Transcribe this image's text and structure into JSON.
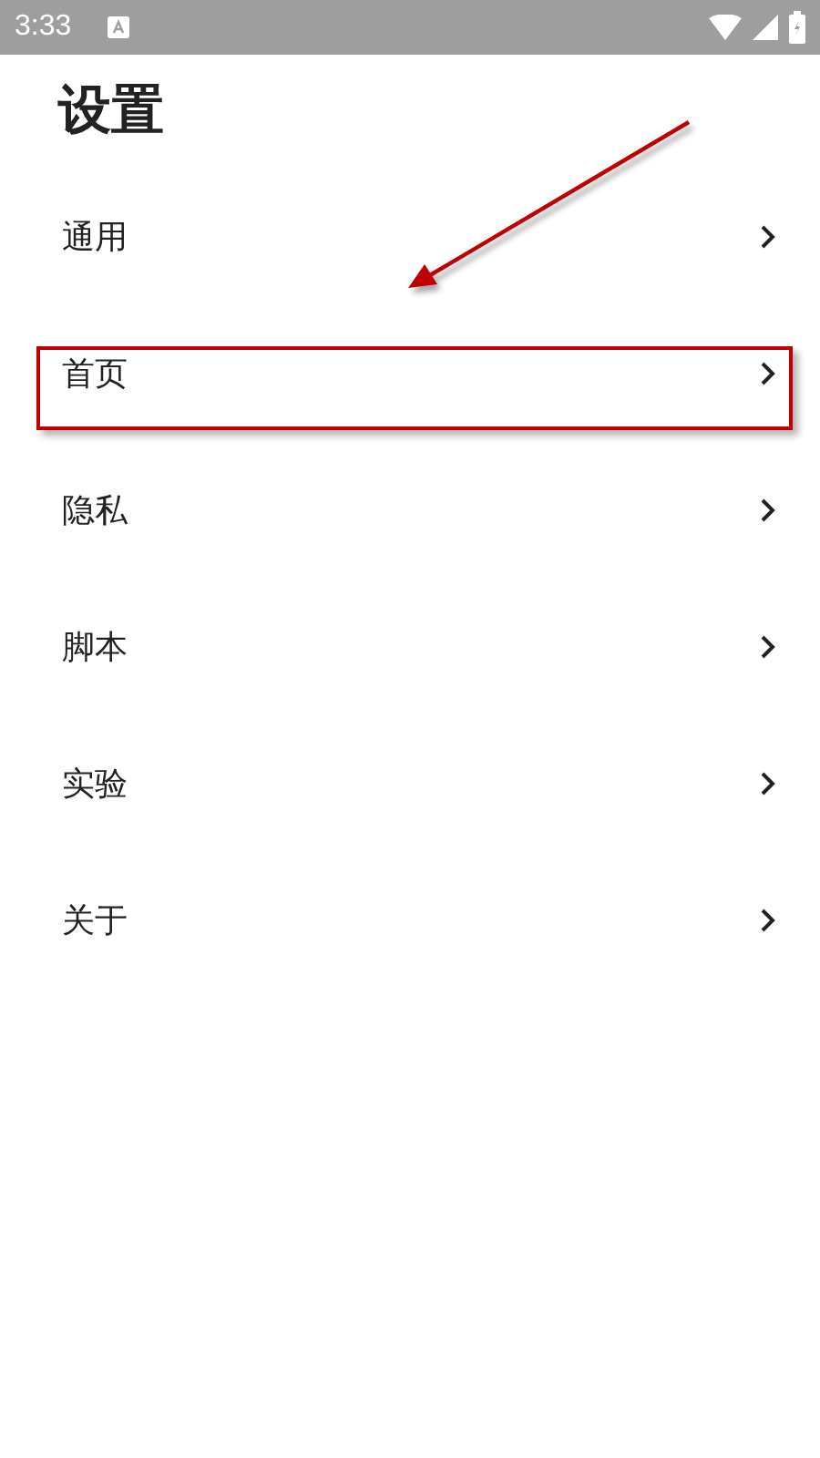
{
  "status_bar": {
    "time": "3:33"
  },
  "title": "设置",
  "items": [
    {
      "label": "通用",
      "highlighted": false
    },
    {
      "label": "首页",
      "highlighted": true
    },
    {
      "label": "隐私",
      "highlighted": false
    },
    {
      "label": "脚本",
      "highlighted": false
    },
    {
      "label": "实验",
      "highlighted": false
    },
    {
      "label": "关于",
      "highlighted": false
    }
  ]
}
